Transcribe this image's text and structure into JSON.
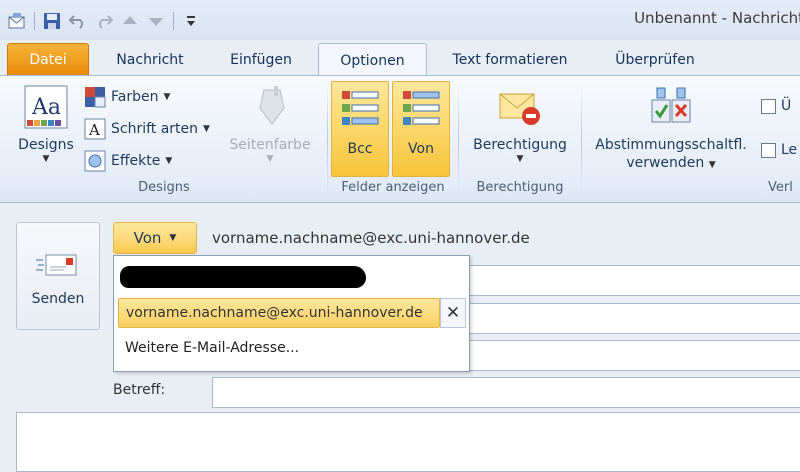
{
  "window": {
    "title": "Unbenannt - Nachricht"
  },
  "qat": {
    "items": [
      "send-receive",
      "save",
      "undo",
      "redo",
      "previous",
      "next",
      "customize"
    ]
  },
  "tabs": [
    {
      "label": "Datei"
    },
    {
      "label": "Nachricht"
    },
    {
      "label": "Einfügen"
    },
    {
      "label": "Optionen"
    },
    {
      "label": "Text formatieren"
    },
    {
      "label": "Überprüfen"
    }
  ],
  "ribbon": {
    "designs": {
      "designs_label": "Designs",
      "farben_label": "Farben",
      "schriftarten_label": "Schrift arten",
      "effekte_label": "Effekte",
      "seitenfarbe_label": "Seitenfarbe",
      "group_label": "Designs"
    },
    "felder": {
      "bcc_label": "Bcc",
      "von_label": "Von",
      "group_label": "Felder anzeigen"
    },
    "berechtigung": {
      "label": "Berechtigung",
      "group_label": "Berechtigung"
    },
    "verfolgung": {
      "abstimmung_line1": "Abstimmungsschaltfl.",
      "abstimmung_line2": "verwenden",
      "check1_label": "Ü",
      "check2_label": "Le",
      "group_label": "Verl"
    }
  },
  "compose": {
    "send_label": "Senden",
    "von_label": "Von",
    "from_address": "vorname.nachname@exc.uni-hannover.de",
    "betreff_label": "Betreff:",
    "dropdown": {
      "selected_address": "vorname.nachname@exc.uni-hannover.de",
      "more_label": "Weitere E-Mail-Adresse..."
    }
  },
  "colors": {
    "accent_file_tab": "#e88a08",
    "toggle_on": "#fbd564",
    "ribbon_bg": "#e4ecf7"
  }
}
